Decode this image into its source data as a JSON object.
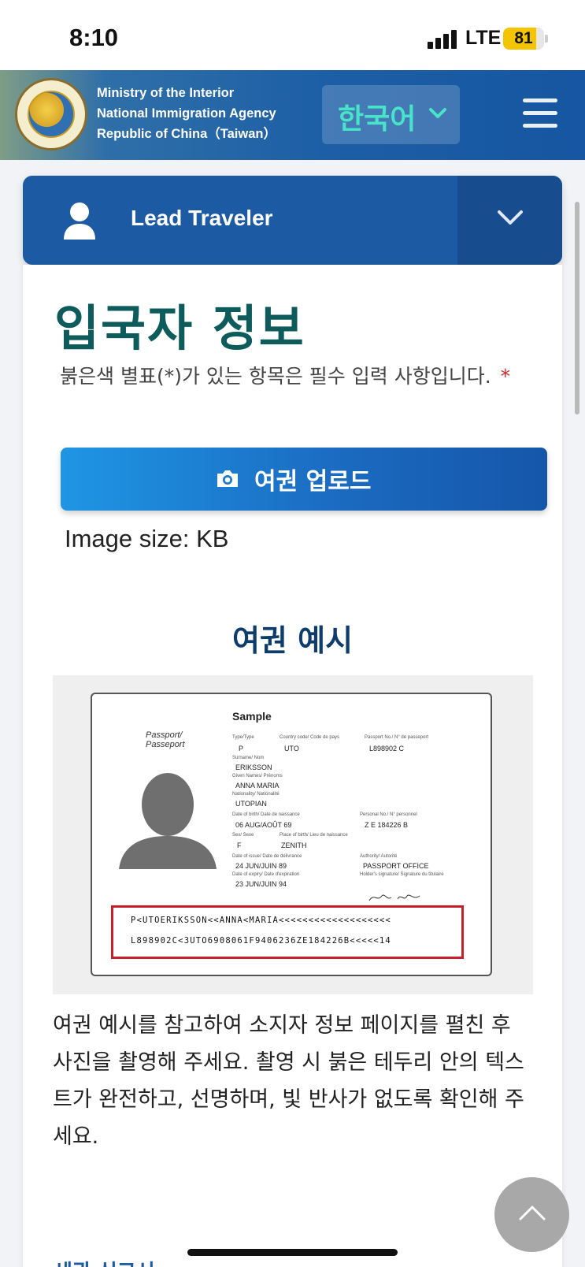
{
  "status_bar": {
    "time": "8:10",
    "network": "LTE",
    "battery_level": "81"
  },
  "header": {
    "org_lines": [
      "Ministry of the Interior",
      "National Immigration Agency",
      "Republic of China（Taiwan）"
    ],
    "language_selected": "한국어",
    "icons": {
      "logo": "agency-emblem",
      "language_dropdown": "chevron-down-icon",
      "menu": "hamburger-menu-icon"
    }
  },
  "lead_traveler": {
    "title": "Lead Traveler",
    "icons": {
      "user": "user-icon",
      "toggle": "chevron-down-icon"
    }
  },
  "form": {
    "page_title": "입국자 정보",
    "required_note": "붉은색 별표(*)가 있는 항목은 필수 입력 사항입니다.",
    "required_star": "*",
    "upload_button_label": "여권 업로드",
    "image_size_label": "Image size: KB",
    "example_title": "여권 예시",
    "instructions": "여권 예시를 참고하여 소지자 정보 페이지를 펼친 후 사진을 촬영해 주세요. 촬영 시 붉은 테두리 안의 텍스트가 완전하고, 선명하며, 빛 반사가 없도록 확인해 주세요."
  },
  "passport_sample": {
    "heading": "Sample",
    "doc_label": "Passport/\nPasseport",
    "fields": {
      "type_label": "Type/Type",
      "type": "P",
      "country_label": "Country code/ Code de pays",
      "country": "UTO",
      "passport_no_label": "Passport No./ N° de passeport",
      "passport_no": "L898902 C",
      "surname_label": "Surname/ Nom",
      "surname": "ERIKSSON",
      "given_names_label": "Given Names/ Prénoms",
      "given_names": "ANNA MARIA",
      "nationality_label": "Nationality/ Nationalité",
      "nationality": "UTOPIAN",
      "dob_label": "Date of birth/ Date de naissance",
      "dob": "06 AUG/AOÛT 69",
      "personal_no_label": "Personal No./ N° personnel",
      "personal_no": "Z E 184226 B",
      "sex_label": "Sex/ Sexe",
      "sex": "F",
      "pob_label": "Place of birth/ Lieu de naissance",
      "pob": "ZENITH",
      "issue_label": "Date of issue/ Date de délivrance",
      "issue": "24 JUN/JUIN 89",
      "authority_label": "Authority/ Autorité",
      "authority": "PASSPORT OFFICE",
      "expiry_label": "Date of expiry/ Date d'expiration",
      "expiry": "23 JUN/JUIN 94",
      "signature_label": "Holder's signature/ Signature du titulaire"
    },
    "mrz_line_1": "P<UTOERIKSSON<<ANNA<MARIA<<<<<<<<<<<<<<<<<<<",
    "mrz_line_2": "L898902C<3UTO6908061F9406236ZE184226B<<<<<14",
    "mrz_highlight_color": "#c8202a"
  },
  "footer": {
    "scroll_top_icon": "chevron-up-icon",
    "partial_text": "세관 신고서"
  },
  "colors": {
    "header_blue": "#1d5fa6",
    "lead_bar": "#1c5aa3",
    "title_teal": "#0d5c5b",
    "language_text": "#48e3c8",
    "required_star": "#d62828"
  }
}
